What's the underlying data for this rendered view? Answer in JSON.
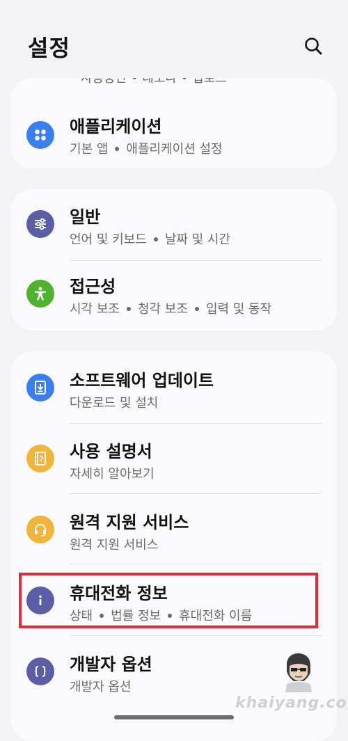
{
  "header": {
    "title": "설정"
  },
  "cut_text": "사용중단 • 데모다 • 법로드",
  "groups": [
    {
      "items": [
        {
          "label": "애플리케이션",
          "subs": [
            "기본 앱",
            "애플리케이션 설정"
          ],
          "icon": "apps-icon",
          "color": "#3a7ff1"
        }
      ]
    },
    {
      "items": [
        {
          "label": "일반",
          "subs": [
            "언어 및 키보드",
            "날짜 및 시간"
          ],
          "icon": "sliders-icon",
          "color": "#5b5ea6"
        },
        {
          "label": "접근성",
          "subs": [
            "시각 보조",
            "청각 보조",
            "입력 및 동작"
          ],
          "icon": "accessibility-icon",
          "color": "#4fb32e"
        }
      ]
    },
    {
      "items": [
        {
          "label": "소프트웨어 업데이트",
          "subs": [
            "다운로드 및 설치"
          ],
          "icon": "download-icon",
          "color": "#3a7ff1"
        },
        {
          "label": "사용 설명서",
          "subs": [
            "자세히 알아보기"
          ],
          "icon": "manual-icon",
          "color": "#f3b43a"
        },
        {
          "label": "원격 지원 서비스",
          "subs": [
            "원격 지원 서비스"
          ],
          "icon": "headset-icon",
          "color": "#f3b43a"
        },
        {
          "label": "휴대전화 정보",
          "subs": [
            "상태",
            "법률 정보",
            "휴대전화 이름"
          ],
          "icon": "info-icon",
          "color": "#5b5ea6"
        },
        {
          "label": "개발자 옵션",
          "subs": [
            "개발자 옵션"
          ],
          "icon": "developer-braces-icon",
          "color": "#5b5ea6"
        }
      ]
    }
  ],
  "watermark": "khaiyang.com"
}
